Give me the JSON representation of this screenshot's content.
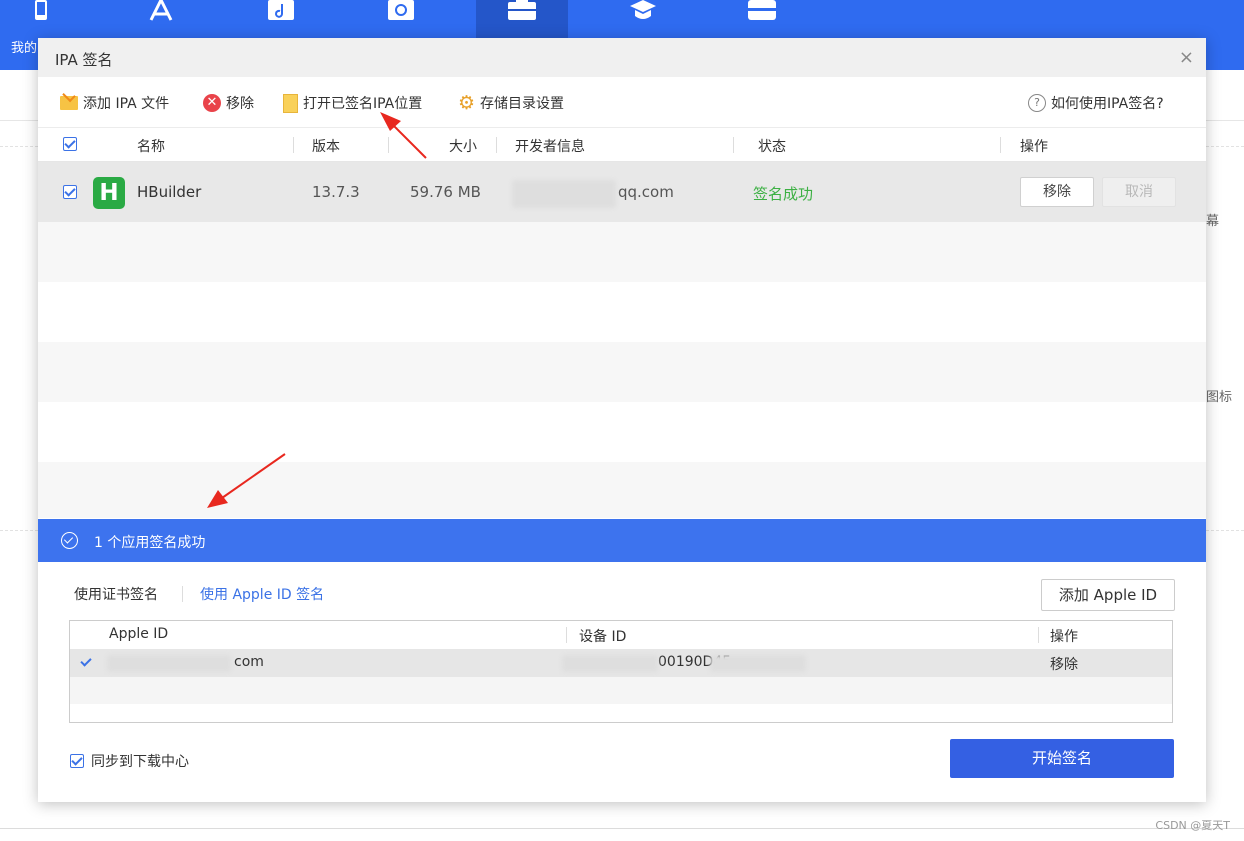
{
  "app": {
    "nav_label": "我的",
    "side_texts": [
      "幕",
      "图标"
    ],
    "watermark": "CSDN @夏天T"
  },
  "dialog": {
    "title": "IPA 签名",
    "close": "×",
    "toolbar": {
      "add_ipa": "添加 IPA 文件",
      "remove": "移除",
      "open_signed": "打开已签名IPA位置",
      "storage": "存储目录设置",
      "help": "如何使用IPA签名?"
    },
    "table": {
      "headers": [
        "名称",
        "版本",
        "大小",
        "开发者信息",
        "状态",
        "操作"
      ],
      "rows": [
        {
          "icon_letter": "H",
          "name": "HBuilder",
          "version": "13.7.3",
          "size": "59.76 MB",
          "developer_suffix": "qq.com",
          "status": "签名成功",
          "remove_label": "移除",
          "cancel_label": "取消"
        }
      ]
    },
    "banner": "1 个应用签名成功",
    "tabs": {
      "cert": "使用证书签名",
      "apple_id": "使用 Apple ID 签名"
    },
    "add_apple_id": "添加 Apple ID",
    "apple_table": {
      "headers": [
        "Apple ID",
        "设备 ID",
        "操作"
      ],
      "rows": [
        {
          "apple_id_suffix": "com",
          "device_id_partial": "00190D45",
          "action": "移除"
        }
      ]
    },
    "sync_label": "同步到下载中心",
    "start_button": "开始签名"
  },
  "colors": {
    "brand_blue": "#2f6bf0",
    "banner_blue": "#3d73ee",
    "success_green": "#3cb043",
    "start_button": "#3460e3"
  }
}
